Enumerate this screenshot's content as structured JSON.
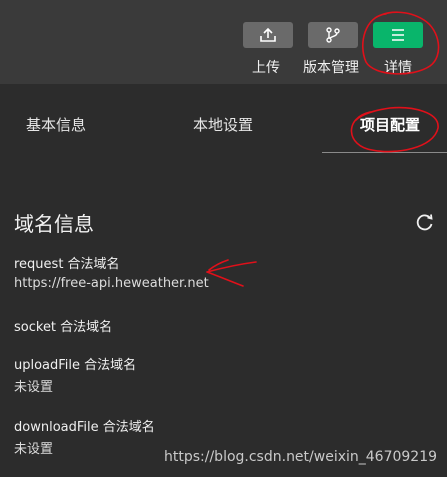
{
  "toolbar": {
    "upload_label": "上传",
    "version_label": "版本管理",
    "details_label": "详情",
    "upload_icon": "upload-icon",
    "version_icon": "branch-icon",
    "details_icon": "menu-icon",
    "active_color": "#09b56b"
  },
  "tabs": [
    {
      "label": "基本信息",
      "selected": false
    },
    {
      "label": "本地设置",
      "selected": false
    },
    {
      "label": "项目配置",
      "selected": true
    }
  ],
  "domain_section": {
    "title": "域名信息",
    "refresh_icon": "refresh-icon",
    "fields": [
      {
        "label": "request 合法域名",
        "value": "https://free-api.heweather.net"
      },
      {
        "label": "socket 合法域名",
        "value": ""
      },
      {
        "label": "uploadFile 合法域名",
        "value": "未设置"
      },
      {
        "label": "downloadFile 合法域名",
        "value": "未设置"
      }
    ]
  },
  "watermark": "https://blog.csdn.net/weixin_46709219",
  "annotation_color": "#e0101a"
}
